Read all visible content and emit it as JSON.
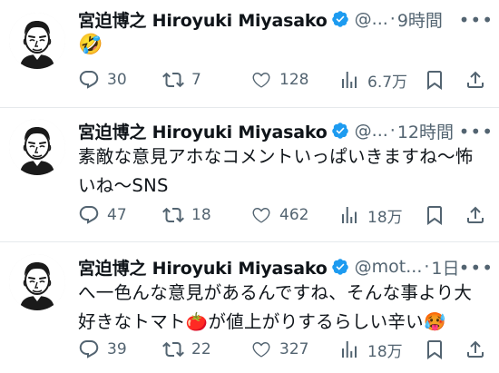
{
  "tweets": [
    {
      "author_name": "宮迫博之 Hiroyuki Miyasako",
      "handle": "@...",
      "separator": "·",
      "time": "9時間",
      "text_lines": [],
      "emoji": "🤣",
      "replies": "30",
      "retweets": "7",
      "likes": "128",
      "views": "6.7万"
    },
    {
      "author_name": "宮迫博之 Hiroyuki Miyasako",
      "handle": "@...",
      "separator": "·",
      "time": "12時間",
      "text_lines": [
        "素敵な意見アホなコメントいっぱいきますね〜怖",
        "いね〜SNS"
      ],
      "replies": "47",
      "retweets": "18",
      "likes": "462",
      "views": "18万"
    },
    {
      "author_name": "宮迫博之 Hiroyuki Miyasako",
      "handle": "@mot...",
      "separator": "·",
      "time": "1日",
      "text_lines": [
        "へ一色んな意見があるんですね、そんな事より大",
        "好きなトマト🍅が値上がりするらしい辛い🥵"
      ],
      "replies": "39",
      "retweets": "22",
      "likes": "327",
      "views": "18万"
    }
  ],
  "icons": {
    "reply": "reply-icon",
    "retweet": "retweet-icon",
    "like": "heart-icon",
    "views": "views-icon",
    "bookmark": "bookmark-icon",
    "share": "share-icon",
    "verified": "verified-badge-icon",
    "more": "more-icon"
  },
  "colors": {
    "text": "#0f1419",
    "secondary": "#536471",
    "verified": "#1d9bf0",
    "divider": "#e6e9ec"
  }
}
